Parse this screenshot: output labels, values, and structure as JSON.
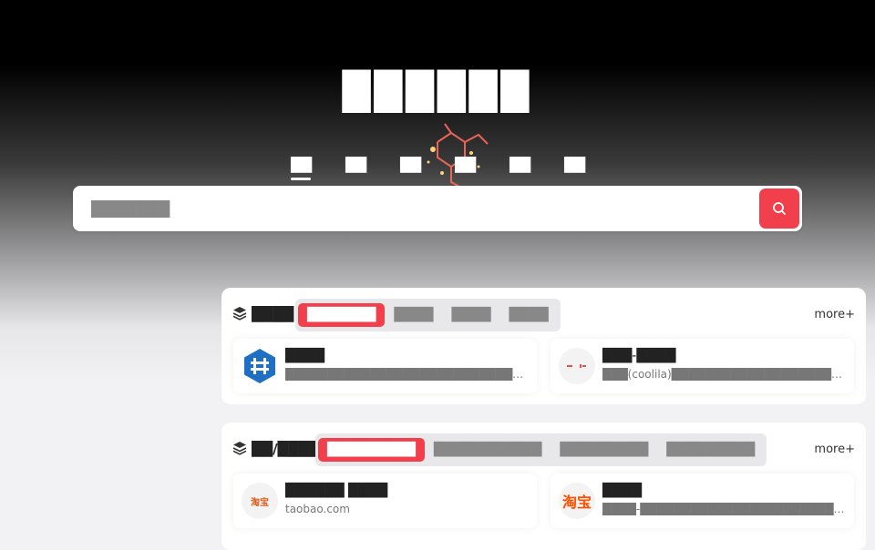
{
  "header": {
    "title": "██████",
    "tabs": [
      "██",
      "██",
      "██",
      "██",
      "██",
      "██"
    ],
    "active_tab": 0
  },
  "search": {
    "placeholder": "███████",
    "button_icon": "search-icon"
  },
  "sections": [
    {
      "icon": "layers-icon",
      "title": "████",
      "subtabs": [
        "███████",
        "████",
        "████",
        "████"
      ],
      "more": "more+",
      "sites": [
        {
          "name": "████",
          "desc": "██████████████████████████████████████████████",
          "logo": "blue-hexagon-logo"
        },
        {
          "name": "███-████",
          "desc": "███(coolila)██████████████████████████████████",
          "logo": "red-text-logo"
        }
      ]
    },
    {
      "icon": "layers-icon",
      "title": "██/████",
      "subtabs": [
        "█████████",
        "███████████",
        "█████████",
        "█████████"
      ],
      "more": "more+",
      "sites": [
        {
          "name": "██████ ████",
          "desc": "taobao.com",
          "logo": "taobao-logo",
          "logo_text": "淘宝"
        },
        {
          "name": "████",
          "desc": "████-████████████████████████████",
          "logo": "taobao-orange-logo",
          "logo_text": "淘宝"
        }
      ]
    }
  ],
  "colors": {
    "accent": "#f1404b",
    "hero_top": "#000000",
    "page_bg": "#f2f2f4"
  }
}
